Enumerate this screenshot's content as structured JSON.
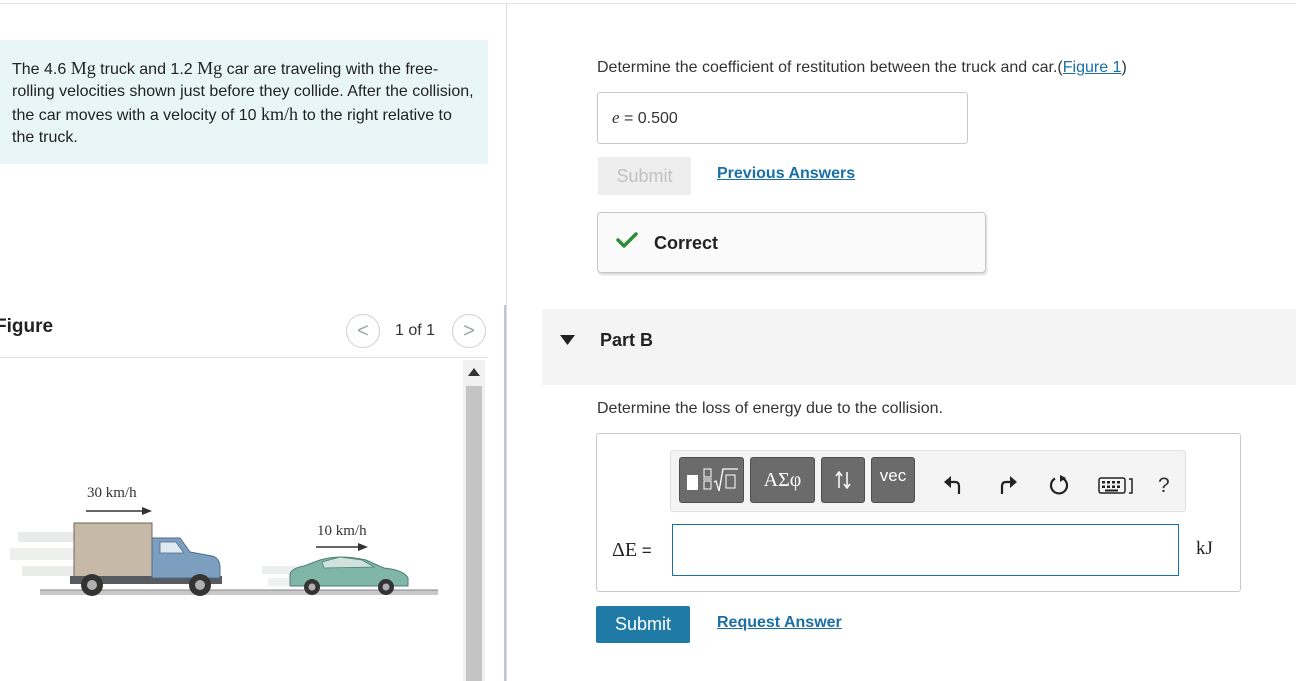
{
  "problem": {
    "p1": "The 4.6 ",
    "m1": "Mg",
    "p2": " truck and 1.2 ",
    "m2": "Mg",
    "p3": " car are traveling with the free-rolling velocities shown just before they collide. After the collision, the car moves with a velocity of 10 ",
    "m3": "km/h",
    "p4": " to the right relative to the truck."
  },
  "figure": {
    "title": "Figure",
    "count": "1 of 1",
    "prev_glyph": "<",
    "next_glyph": ">",
    "truck_speed": "30 km/h",
    "car_speed": "10 km/h"
  },
  "part_a": {
    "question": "Determine the coefficient of restitution between the truck and car.",
    "fig_open": "(",
    "fig_link": "Figure 1",
    "fig_close": ")",
    "answer_var": "e",
    "answer_eq": " = ",
    "answer_value": "0.500",
    "submit_label": "Submit",
    "previous_answers": "Previous Answers",
    "feedback": "Correct"
  },
  "part_b": {
    "label": "Part B",
    "question": "Determine the loss of energy due to the collision.",
    "toolbar": {
      "greek": "ΑΣφ",
      "vec": "vec",
      "help": "?"
    },
    "answer_label": "ΔE",
    "answer_eq": " =",
    "answer_value": "",
    "unit": "kJ",
    "submit_label": "Submit",
    "request_answer": "Request Answer"
  },
  "colors": {
    "accent": "#1f7ba6",
    "link": "#1a6fa6",
    "correct": "#2e8b3a",
    "problem_bg": "#e8f6f7"
  }
}
